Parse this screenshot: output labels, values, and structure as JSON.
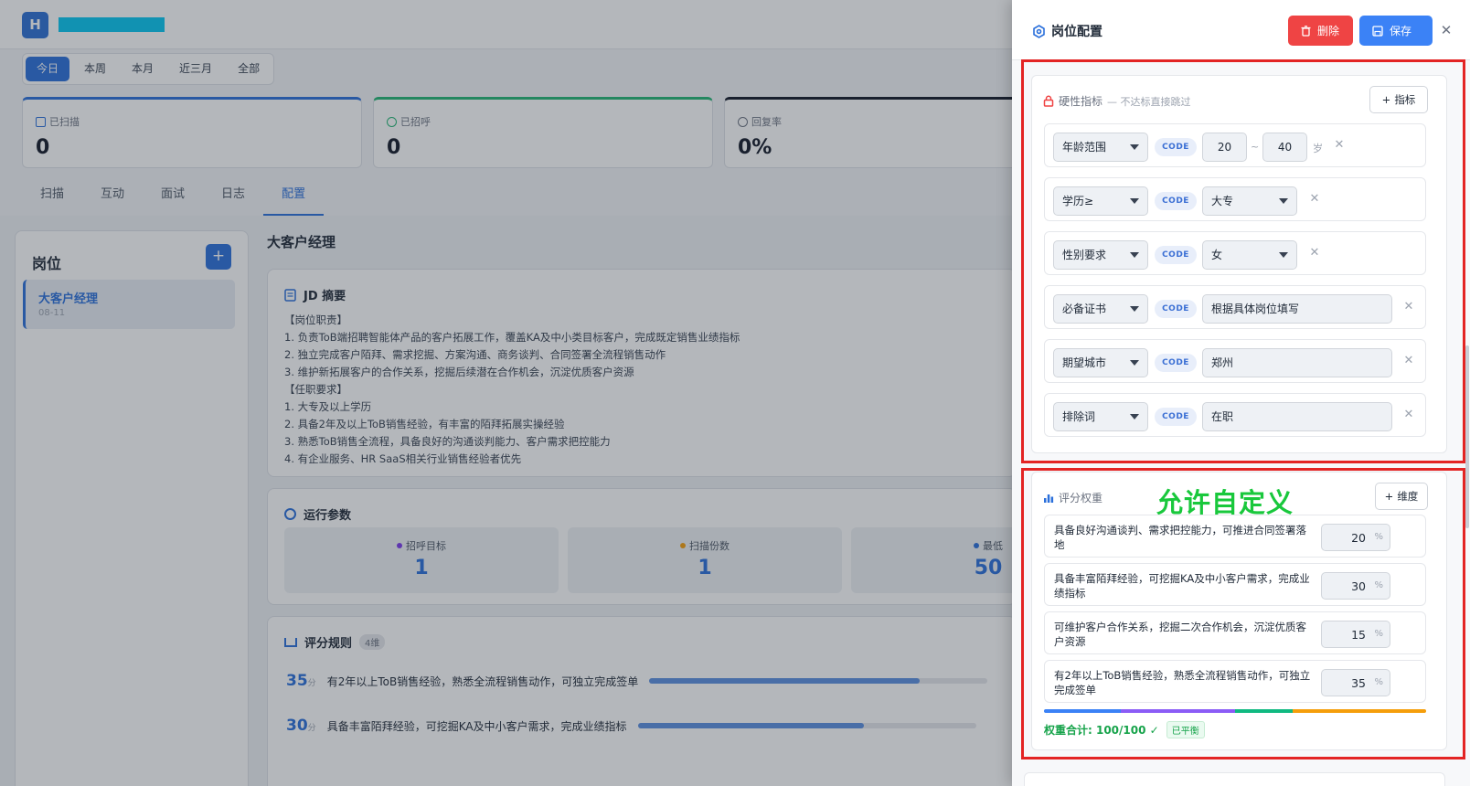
{
  "header": {
    "avatar_letter": "H"
  },
  "period_tabs": [
    {
      "label": "今日",
      "active": true
    },
    {
      "label": "本周"
    },
    {
      "label": "本月"
    },
    {
      "label": "近三月"
    },
    {
      "label": "全部"
    }
  ],
  "stats": [
    {
      "label": "已扫描",
      "value": "0",
      "color": "#2a6fdb"
    },
    {
      "label": "已招呼",
      "value": "0",
      "color": "#22b573"
    },
    {
      "label": "回复率",
      "value": "0%",
      "color": "#111827"
    }
  ],
  "main_tabs": [
    {
      "label": "扫描"
    },
    {
      "label": "互动"
    },
    {
      "label": "面试"
    },
    {
      "label": "日志"
    },
    {
      "label": "配置",
      "active": true
    }
  ],
  "positions": {
    "title": "岗位",
    "add_label": "+",
    "items": [
      {
        "name": "大客户经理",
        "date": "08-11"
      }
    ]
  },
  "job": {
    "title": "大客户经理",
    "jd_heading": "JD 摘要",
    "jd_lines": [
      "【岗位职责】",
      "1. 负责ToB端招聘智能体产品的客户拓展工作，覆盖KA及中小类目标客户，完成既定销售业绩指标",
      "2. 独立完成客户陌拜、需求挖掘、方案沟通、商务谈判、合同签署全流程销售动作",
      "3. 维护新拓展客户的合作关系，挖掘后续潜在合作机会，沉淀优质客户资源",
      "【任职要求】",
      "1. 大专及以上学历",
      "2. 具备2年及以上ToB销售经验，有丰富的陌拜拓展实操经验",
      "3. 熟悉ToB销售全流程，具备良好的沟通谈判能力、客户需求把控能力",
      "4. 有企业服务、HR SaaS相关行业销售经验者优先"
    ],
    "params_heading": "运行参数",
    "params": [
      {
        "label": "招呼目标",
        "value": "1",
        "dot": "#7c3aed"
      },
      {
        "label": "扫描份数",
        "value": "1",
        "dot": "#f59e0b"
      },
      {
        "label": "最低",
        "value": "50",
        "dot": "#2a6fdb"
      }
    ],
    "rules_heading": "评分规则",
    "rules_badge": "4维",
    "rules": [
      {
        "score": "35",
        "unit": "分",
        "text": "有2年以上ToB销售经验，熟悉全流程销售动作，可独立完成签单",
        "fill": 0.8
      },
      {
        "score": "30",
        "unit": "分",
        "text": "具备丰富陌拜经验，可挖掘KA及中小客户需求，完成业绩指标",
        "fill": 0.67
      }
    ]
  },
  "drawer": {
    "title": "岗位配置",
    "delete_label": "删除",
    "save_label": "保存",
    "hard": {
      "title": "硬性指标",
      "subtitle": "— 不达标直接跳过",
      "add_label": "指标",
      "code": "CODE",
      "age": {
        "field": "年龄范围",
        "min": "20",
        "sep": "~",
        "max": "40",
        "unit": "岁"
      },
      "edu": {
        "field": "学历≥",
        "value": "大专"
      },
      "gender": {
        "field": "性别要求",
        "value": "女"
      },
      "cert": {
        "field": "必备证书",
        "value": "根据具体岗位填写"
      },
      "city": {
        "field": "期望城市",
        "value": "郑州"
      },
      "exclude": {
        "field": "排除词",
        "value": "在职"
      }
    },
    "weights": {
      "title": "评分权重",
      "annotation": "允许自定义",
      "add_label": "维度",
      "unit": "%",
      "items": [
        {
          "text": "具备良好沟通谈判、需求把控能力，可推进合同签署落地",
          "value": "20",
          "color": "#3b82f6"
        },
        {
          "text": "具备丰富陌拜经验，可挖掘KA及中小客户需求，完成业绩指标",
          "value": "30",
          "color": "#8b5cf6"
        },
        {
          "text": "可维护客户合作关系，挖掘二次合作机会，沉淀优质客户资源",
          "value": "15",
          "color": "#10b981"
        },
        {
          "text": "有2年以上ToB销售经验，熟悉全流程销售动作，可独立完成签单",
          "value": "35",
          "color": "#f59e0b"
        }
      ],
      "total": "权重合计: 100/100 ✓",
      "balanced": "已平衡"
    }
  }
}
